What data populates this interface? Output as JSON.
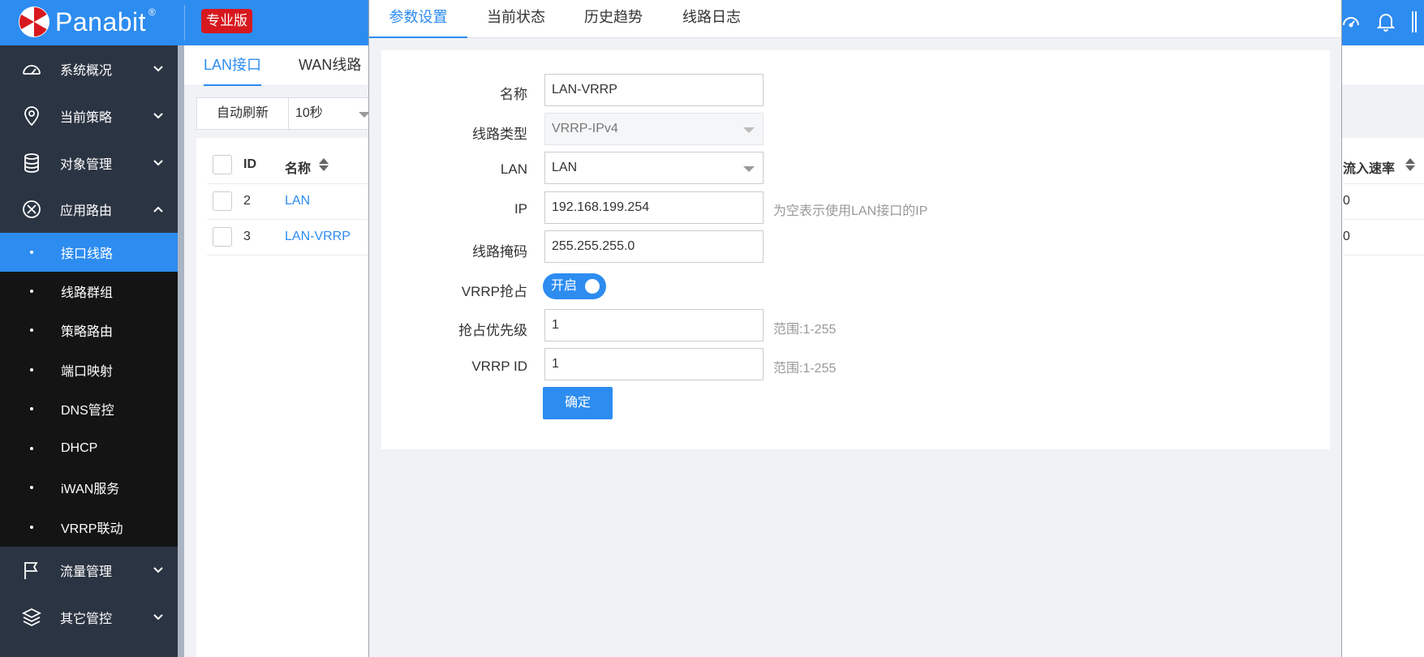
{
  "header": {
    "logo_text": "Panabit",
    "logo_reg": "®",
    "edition_badge": "专业版",
    "icons": [
      "dashboard-icon",
      "bell-icon",
      "more-icon"
    ]
  },
  "sidebar": {
    "items_top": [
      {
        "label": "系统概况",
        "icon": "gauge-icon"
      },
      {
        "label": "当前策略",
        "icon": "map-pin-icon"
      },
      {
        "label": "对象管理",
        "icon": "database-icon"
      },
      {
        "label": "应用路由",
        "icon": "crosshair-icon"
      }
    ],
    "submenu": [
      "接口线路",
      "线路群组",
      "策略路由",
      "端口映射",
      "DNS管控",
      "DHCP",
      "iWAN服务",
      "VRRP联动"
    ],
    "items_bottom": [
      {
        "label": "流量管理",
        "icon": "flag-icon"
      },
      {
        "label": "其它管控",
        "icon": "layers-icon"
      }
    ]
  },
  "page_tabs": [
    "LAN接口",
    "WAN线路"
  ],
  "toolbar": {
    "refresh_label": "自动刷新",
    "interval_value": "10秒"
  },
  "table": {
    "headers": {
      "id": "ID",
      "name": "名称",
      "in_rate": "流入速率"
    },
    "rows": [
      {
        "id": "2",
        "name": "LAN",
        "in_rate": "0"
      },
      {
        "id": "3",
        "name": "LAN-VRRP",
        "in_rate": "0"
      }
    ]
  },
  "dialog": {
    "tabs": [
      "参数设置",
      "当前状态",
      "历史趋势",
      "线路日志"
    ],
    "form": {
      "name_label": "名称",
      "name_value": "LAN-VRRP",
      "type_label": "线路类型",
      "type_value": "VRRP-IPv4",
      "lan_label": "LAN",
      "lan_value": "LAN",
      "ip_label": "IP",
      "ip_value": "192.168.199.254",
      "ip_hint": "为空表示使用LAN接口的IP",
      "mask_label": "线路掩码",
      "mask_value": "255.255.255.0",
      "preempt_label": "VRRP抢占",
      "preempt_toggle": "开启",
      "priority_label": "抢占优先级",
      "priority_value": "1",
      "priority_hint": "范围:1-255",
      "vrid_label": "VRRP ID",
      "vrid_value": "1",
      "vrid_hint": "范围:1-255",
      "submit_label": "确定"
    }
  },
  "colors": {
    "primary": "#2d8cf0",
    "sidebar": "#2b3442",
    "submenu": "#141414",
    "badge": "#d7181e"
  }
}
